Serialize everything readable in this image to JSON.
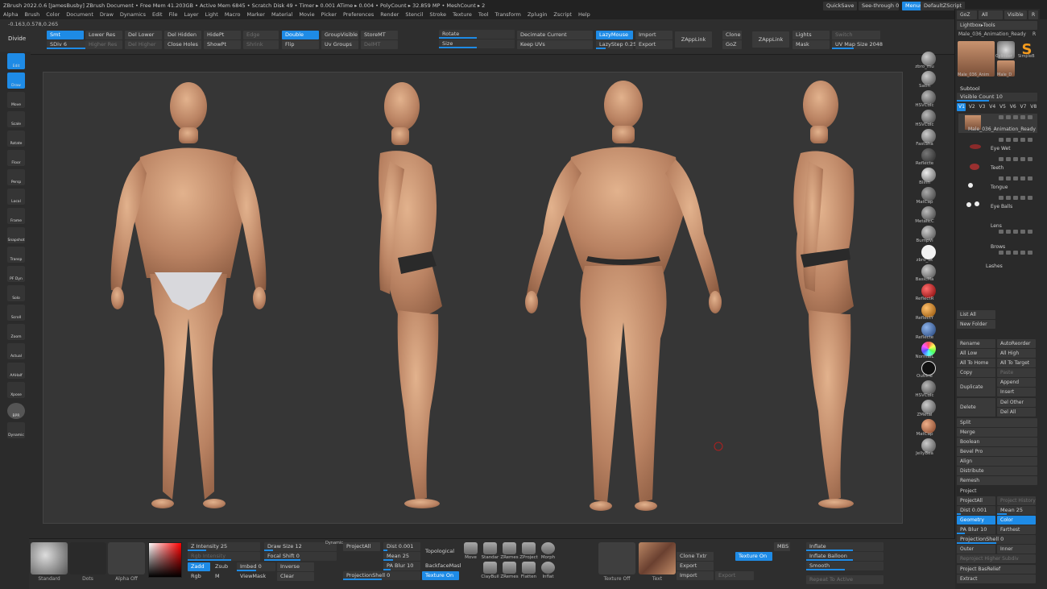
{
  "title_bar": {
    "text": "ZBrush 2022.0.6 [JamesBusby]   ZBrush Document      • Free Mem 41.203GB • Active Mem 6845 • Scratch Disk 49 • Timer ▸ 0.001 ATime ▸ 0.004 • PolyCount ▸ 32.859 MP • MeshCount ▸ 2",
    "quicksave": "QuickSave",
    "see_through": "See-through  0",
    "menus_btn": "Menus",
    "zscript": "DefaultZScript"
  },
  "menu": [
    "Alpha",
    "Brush",
    "Color",
    "Document",
    "Draw",
    "Dynamics",
    "Edit",
    "File",
    "Layer",
    "Light",
    "Macro",
    "Marker",
    "Material",
    "Movie",
    "Picker",
    "Preferences",
    "Render",
    "Stencil",
    "Stroke",
    "Texture",
    "Tool",
    "Transform",
    "Zplugin",
    "Zscript",
    "Help"
  ],
  "coords": "-0.163,0.578,0.265",
  "topbar": {
    "divide": "Divide",
    "smt": "Smt",
    "sdiv": "SDiv 6",
    "lower_res": "Lower Res",
    "higher_res": "Higher Res",
    "del_lower": "Del Lower",
    "del_higher": "Del Higher",
    "del_hidden": "Del Hidden",
    "close_holes": "Close Holes",
    "hidept": "HidePt",
    "showpt": "ShowPt",
    "edge": "Edge",
    "shrink": "Shrink",
    "double": "Double",
    "flip": "Flip",
    "groupvisible": "GroupVisible",
    "uv_groups": "Uv Groups",
    "storemt": "StoreMT",
    "delmt": "DelMT",
    "rotate": "Rotate",
    "size": "Size",
    "decimate": "Decimate Current",
    "keep_uvs": "Keep UVs",
    "lazymouse": "LazyMouse",
    "lazystep": "LazyStep 0.25",
    "import": "Import",
    "export": "Export",
    "zapplink1": "ZAppLink",
    "clone": "Clone",
    "goz": "GoZ",
    "zapplink2": "ZAppLink",
    "lights": "Lights",
    "mask": "Mask",
    "switch": "Switch",
    "uv_map": "UV Map Size 2048"
  },
  "left_shelf": [
    "Edit",
    "Draw",
    "Move",
    "Scale",
    "Rotate",
    "Floor",
    "Persp",
    "Local",
    "Frame",
    "Snapshot",
    "Transp",
    "PF Dyn",
    "Solo",
    "Scroll",
    "Zoom",
    "Actual",
    "AAHalf",
    "Xpose",
    "BPR",
    "Dynamic"
  ],
  "right_materials": [
    {
      "name": "zbro_mu",
      "color": "#9a9a9a"
    },
    {
      "name": "Satin",
      "color": "#8c8c8c"
    },
    {
      "name": "HSVColc",
      "color": "#7a7a7a"
    },
    {
      "name": "HSVColc",
      "color": "#7a7a7a"
    },
    {
      "name": "FastSha",
      "color": "#909090"
    },
    {
      "name": "Reflecte",
      "color": "#555"
    },
    {
      "name": "Blinn",
      "color": "#a8a8a8"
    },
    {
      "name": "MatCap",
      "color": "#6e6e6e"
    },
    {
      "name": "MetalicC",
      "color": "#777"
    },
    {
      "name": "BumpVi",
      "color": "#8a8a8a"
    },
    {
      "name": "zbro_sk",
      "color": "#f0f0f0"
    },
    {
      "name": "BasicMa",
      "color": "#999"
    },
    {
      "name": "ReflectR",
      "color": "#cc2020"
    },
    {
      "name": "ReflectY",
      "color": "#d27a10"
    },
    {
      "name": "Reflecte",
      "color": "#3f6fb0"
    },
    {
      "name": "NormalL",
      "color": "#6a8ad0"
    },
    {
      "name": "Outline",
      "color": "#111"
    },
    {
      "name": "HSVColc",
      "color": "#777"
    },
    {
      "name": "ZMetal",
      "color": "#8f8f8f"
    },
    {
      "name": "MatCap",
      "color": "#c97a55"
    },
    {
      "name": "JellyBea",
      "color": "#888"
    }
  ],
  "right_panel": {
    "goz": "GoZ",
    "all": "All",
    "visible": "Visible",
    "r": "R",
    "lightbox_tools": "Lightbox▸Tools",
    "tool_name": "Male_036_Animation_Ready",
    "r2": "R",
    "thumb_labels": [
      "Male_036_Anim",
      "Cylinder",
      "SimpleB",
      "Male_D"
    ],
    "subtool": "Subtool",
    "visible_count": "Visible Count 10",
    "versions": [
      "V1",
      "V2",
      "V3",
      "V4",
      "V5",
      "V6",
      "V7",
      "V8"
    ],
    "subtools": [
      "Male_036_Animation_Ready",
      "Eye Wet",
      "Teeth",
      "Tongue",
      "Eye Balls",
      "Lens",
      "Brows",
      "Lashes"
    ],
    "list_all": "List All",
    "new_folder": "New Folder",
    "rename": "Rename",
    "autoreorder": "AutoReorder",
    "all_low": "All Low",
    "all_high": "All High",
    "all_to_home": "All To Home",
    "all_to_target": "All To Target",
    "copy": "Copy",
    "paste": "Paste",
    "duplicate": "Duplicate",
    "append": "Append",
    "insert": "Insert",
    "delete": "Delete",
    "del_other": "Del Other",
    "del_all": "Del All",
    "split": "Split",
    "merge": "Merge",
    "boolean": "Boolean",
    "bevel_pro": "Bevel Pro",
    "align": "Align",
    "distribute": "Distribute",
    "remesh": "Remesh",
    "project": "Project",
    "projectall": "ProjectAll",
    "project_history": "Project History",
    "dist": "Dist 0.001",
    "mean": "Mean 25",
    "geometry": "Geometry",
    "color": "Color",
    "pa_blur": "PA Blur 10",
    "farthest": "Farthest",
    "projectionshell": "ProjectionShell 0",
    "outer": "Outer",
    "inner": "Inner",
    "reproject": "Reproject Higher Subdiv",
    "project_basrelief": "Project BasRelief",
    "extract": "Extract"
  },
  "bottom": {
    "standard": "Standard",
    "dots": "Dots",
    "alpha_off": "Alpha Off",
    "z_intensity": "Z Intensity 25",
    "rgb_intensity": "Rgb Intensity",
    "zadd": "Zadd",
    "zsub": "Zsub",
    "zcut": "Zcut",
    "rgb": "Rgb",
    "m": "M",
    "mrgb": "Mrgb",
    "imbed": "Imbed 0",
    "viewmask": "ViewMask",
    "draw_size": "Draw Size 12",
    "dynamic": "Dynamic",
    "focal_shift": "Focal Shift 0",
    "inverse": "Inverse",
    "clear": "Clear",
    "projectall": "ProjectAll",
    "dist": "Dist 0.001",
    "mean": "Mean 25",
    "pa_blur": "PA Blur 10",
    "projectionshell": "ProjectionShell 0",
    "topological": "Topological",
    "backfacemask": "BackfaceMask",
    "texture_on": "Texture On",
    "brushes": [
      "Move",
      "Standar",
      "ZRemes",
      "ZProject",
      "Morph",
      "ClayBuil",
      "ZRemes",
      "Flatten",
      "Inflat"
    ],
    "texture_off": "Texture Off",
    "text": "Text",
    "clone_txtr": "Clone Txtr",
    "export": "Export",
    "import": "Import",
    "texture_on2": "Texture On",
    "export2": "Export",
    "mbs": "MBS",
    "inflate": "Inflate",
    "inflate_balloon": "Inflate Balloon",
    "smooth": "Smooth",
    "repeat_active": "Repeat To Active"
  },
  "colors": {
    "accent": "#1e8be6",
    "bg": "#2b2b2b",
    "canvas": "#363636",
    "skin": "#c28f6c"
  }
}
